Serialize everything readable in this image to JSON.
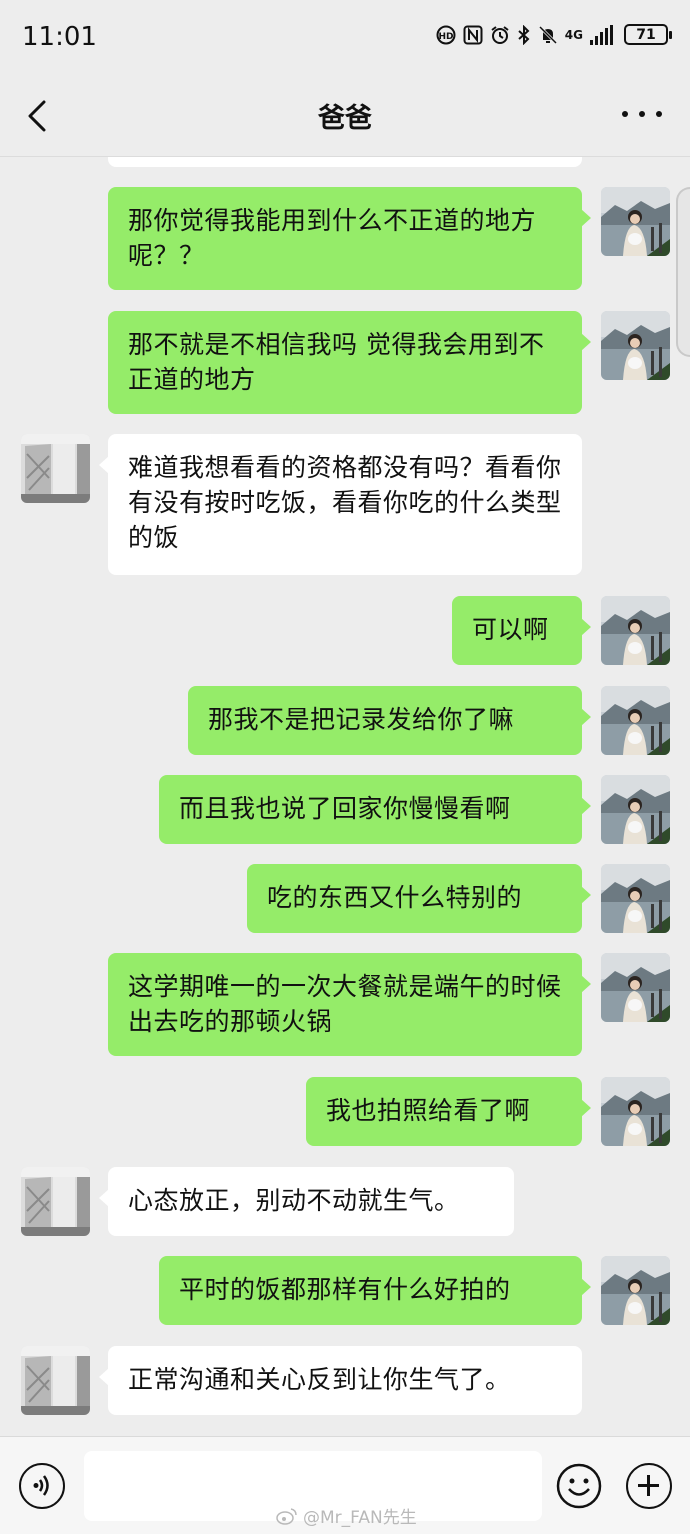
{
  "status_bar": {
    "time": "11:01",
    "network": "4G",
    "battery": "71",
    "icons": [
      "hd-call-icon",
      "nfc-icon",
      "alarm-icon",
      "bluetooth-icon",
      "mute-icon",
      "signal-icon",
      "battery-icon"
    ]
  },
  "header": {
    "title": "爸爸",
    "back_icon": "chevron-left-icon",
    "more_icon": "more-dots-icon"
  },
  "messages": [
    {
      "from": "me",
      "text": "那你觉得我能用到什么不正道的地方呢？？"
    },
    {
      "from": "me",
      "text": "那不就是不相信我吗 觉得我会用到不正道的地方"
    },
    {
      "from": "other",
      "text": "难道我想看看的资格都没有吗？看看你有没有按时吃饭，看看你吃的什么类型的饭"
    },
    {
      "from": "me",
      "text": "可以啊"
    },
    {
      "from": "me",
      "text": "那我不是把记录发给你了嘛"
    },
    {
      "from": "me",
      "text": "而且我也说了回家你慢慢看啊"
    },
    {
      "from": "me",
      "text": "吃的东西又什么特别的"
    },
    {
      "from": "me",
      "text": "这学期唯一的一次大餐就是端午的时候出去吃的那顿火锅"
    },
    {
      "from": "me",
      "text": "我也拍照给看了啊"
    },
    {
      "from": "other",
      "text": "心态放正，别动不动就生气。"
    },
    {
      "from": "me",
      "text": "平时的饭都那样有什么好拍的"
    },
    {
      "from": "other",
      "text": "正常沟通和关心反到让你生气了。"
    }
  ],
  "input_bar": {
    "placeholder": "",
    "voice_icon": "voice-icon",
    "emoji_icon": "emoji-icon",
    "plus_icon": "plus-icon"
  },
  "watermark": "@Mr_FAN先生",
  "colors": {
    "background": "#ededed",
    "my_bubble": "#95ec69",
    "other_bubble": "#ffffff"
  }
}
